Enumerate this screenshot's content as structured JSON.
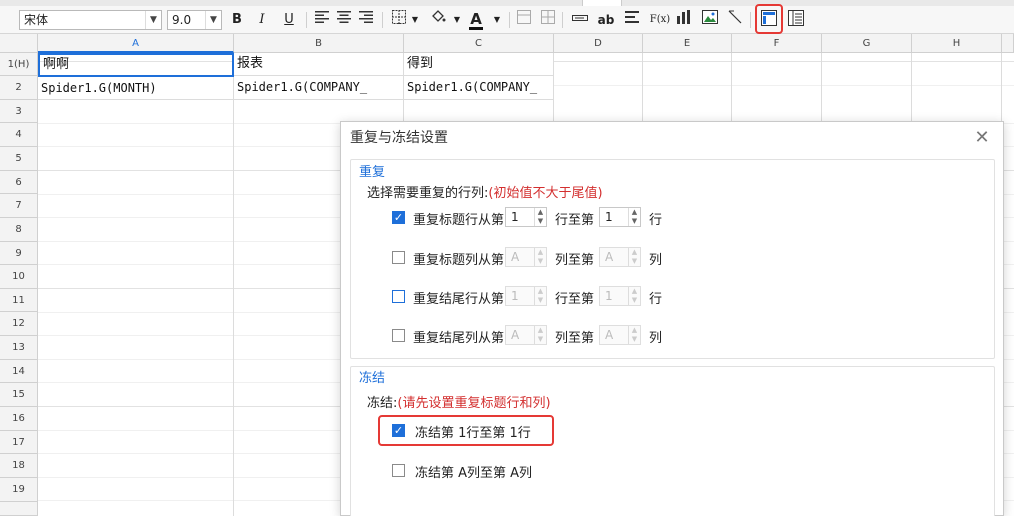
{
  "toolbar": {
    "font_family": "宋体",
    "font_size": "9.0",
    "bold": "B",
    "italic": "I",
    "underline": "U",
    "text_btn": "ab",
    "formula_btn": "F(x)"
  },
  "grid": {
    "columns": [
      "A",
      "B",
      "C",
      "D",
      "E",
      "F",
      "G",
      "H"
    ],
    "rows": [
      "1(H)",
      "2",
      "3",
      "4",
      "5",
      "6",
      "7",
      "8",
      "9",
      "10",
      "11",
      "12",
      "13",
      "14",
      "15",
      "16",
      "17",
      "18",
      "19"
    ],
    "cells": {
      "a1": "啊啊",
      "b1": "报表",
      "c1": "得到",
      "a2": "Spider1.G(MONTH)",
      "b2": "Spider1.G(COMPANY_",
      "c2": "Spider1.G(COMPANY_"
    }
  },
  "dialog": {
    "title": "重复与冻结设置",
    "close": "✕",
    "repeat": {
      "group_title": "重复",
      "prompt": "选择需要重复的行列:",
      "note": "(初始值不大于尾值)",
      "rows": [
        {
          "label_from": "重复标题行从第",
          "start": "1",
          "label_to": "行至第",
          "end": "1",
          "unit": "行",
          "checked": true
        },
        {
          "label_from": "重复标题列从第",
          "start": "A",
          "label_to": "列至第",
          "end": "A",
          "unit": "列",
          "checked": false
        },
        {
          "label_from": "重复结尾行从第",
          "start": "1",
          "label_to": "行至第",
          "end": "1",
          "unit": "行",
          "checked": false
        },
        {
          "label_from": "重复结尾列从第",
          "start": "A",
          "label_to": "列至第",
          "end": "A",
          "unit": "列",
          "checked": false
        }
      ]
    },
    "freeze": {
      "group_title": "冻结",
      "prompt": "冻结:",
      "note": "(请先设置重复标题行和列)",
      "row_option": "冻结第 1行至第 1行",
      "col_option": "冻结第 A列至第 A列"
    }
  },
  "colors": {
    "accent": "#1e6fd9",
    "highlight": "#e53935",
    "note": "#d32f2f"
  }
}
